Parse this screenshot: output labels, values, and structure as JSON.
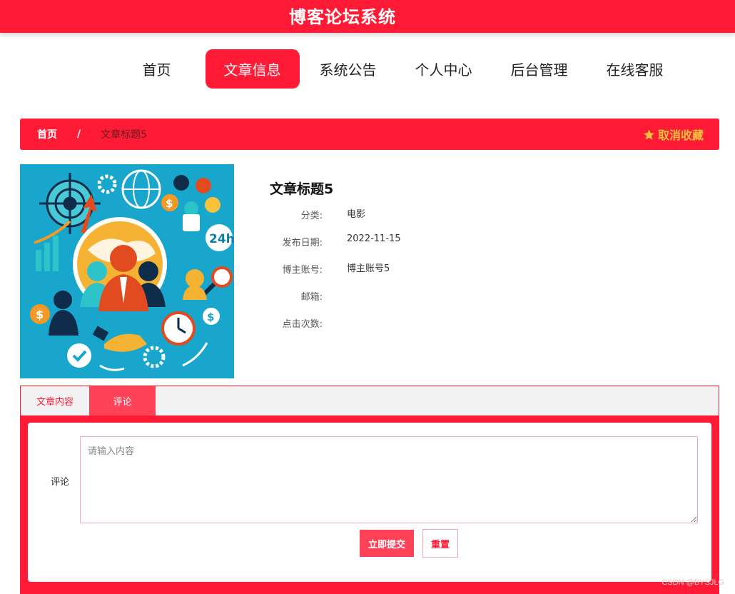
{
  "header": {
    "title": "博客论坛系统"
  },
  "nav": {
    "items": [
      {
        "label": "首页"
      },
      {
        "label": "文章信息"
      },
      {
        "label": "系统公告"
      },
      {
        "label": "个人中心"
      },
      {
        "label": "后台管理"
      },
      {
        "label": "在线客服"
      }
    ],
    "active_index": 1
  },
  "breadcrumb": {
    "home": "首页",
    "separator": "/",
    "current": "文章标题5"
  },
  "favorite": {
    "label": "取消收藏",
    "icon": "star-icon"
  },
  "article": {
    "title": "文章标题5",
    "fields": [
      {
        "label": "分类:",
        "value": "电影"
      },
      {
        "label": "发布日期:",
        "value": "2022-11-15"
      },
      {
        "label": "博主账号:",
        "value": "博主账号5"
      },
      {
        "label": "邮箱:",
        "value": ""
      },
      {
        "label": "点击次数:",
        "value": ""
      }
    ]
  },
  "tabs": [
    {
      "label": "文章内容"
    },
    {
      "label": "评论"
    }
  ],
  "comment": {
    "label": "评论",
    "placeholder": "请输入内容",
    "value": "",
    "submit_label": "立即提交",
    "reset_label": "重置"
  },
  "watermark": "CSDN @BYSJLG",
  "colors": {
    "primary": "#ff1a35",
    "accent": "#ff4257",
    "star": "#f7c23c"
  }
}
